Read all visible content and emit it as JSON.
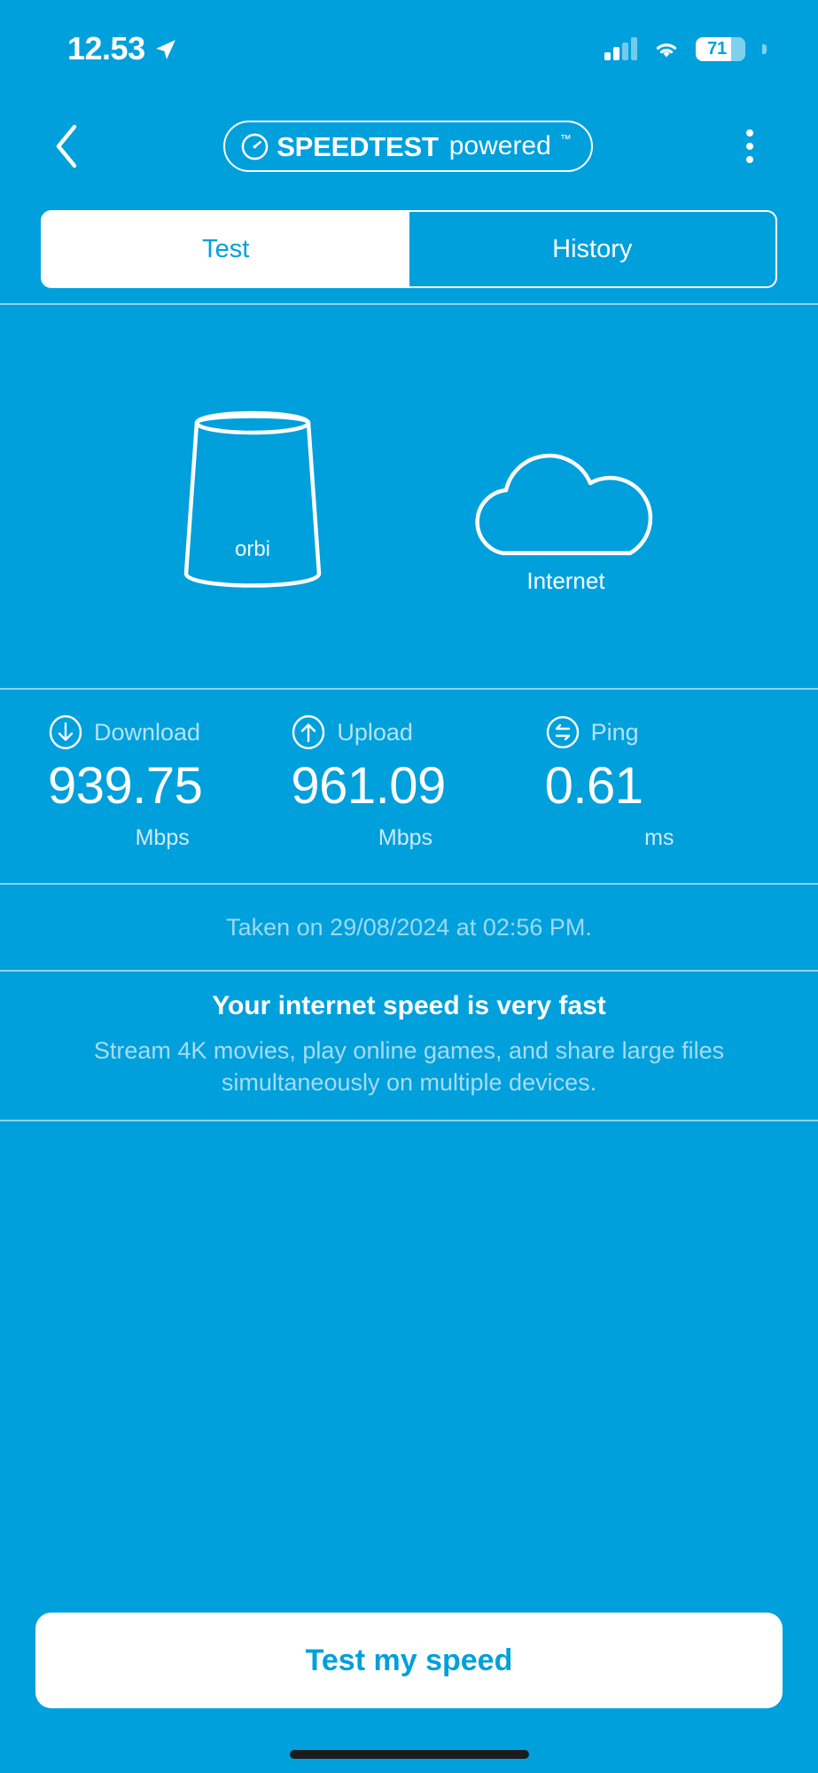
{
  "theme": {
    "background": "#00a0dc",
    "accent": "#ffffff",
    "muted_text": "#a5dcf2",
    "on_white_text": "#00a0dc"
  },
  "status_bar": {
    "time": "12.53",
    "location_icon": "location-arrow-icon",
    "signal_icon": "cellular-signal-icon",
    "wifi_icon": "wifi-icon",
    "battery_percent": "71"
  },
  "header": {
    "back_icon": "chevron-left-icon",
    "logo": {
      "gauge_icon": "speedometer-icon",
      "primary": "SPEEDTEST",
      "secondary": "powered",
      "trademark": "™"
    },
    "menu_icon": "kebab-menu-icon"
  },
  "tabs": [
    {
      "label": "Test",
      "active": true
    },
    {
      "label": "History",
      "active": false
    }
  ],
  "illustration": {
    "router_icon": "orbi-router-icon",
    "router_brand": "orbi",
    "cloud_icon": "cloud-icon",
    "cloud_label": "Internet"
  },
  "metrics": [
    {
      "icon": "download-arrow-icon",
      "name": "Download",
      "value": "939.75",
      "unit": "Mbps"
    },
    {
      "icon": "upload-arrow-icon",
      "name": "Upload",
      "value": "961.09",
      "unit": "Mbps"
    },
    {
      "icon": "ping-exchange-icon",
      "name": "Ping",
      "value": "0.61",
      "unit": "ms"
    }
  ],
  "taken_on": "Taken on 29/08/2024 at 02:56 PM.",
  "advisory": {
    "title": "Your internet speed is very fast",
    "body": "Stream 4K movies, play online games, and share large files simultaneously on multiple devices."
  },
  "cta": {
    "label": "Test my speed"
  }
}
